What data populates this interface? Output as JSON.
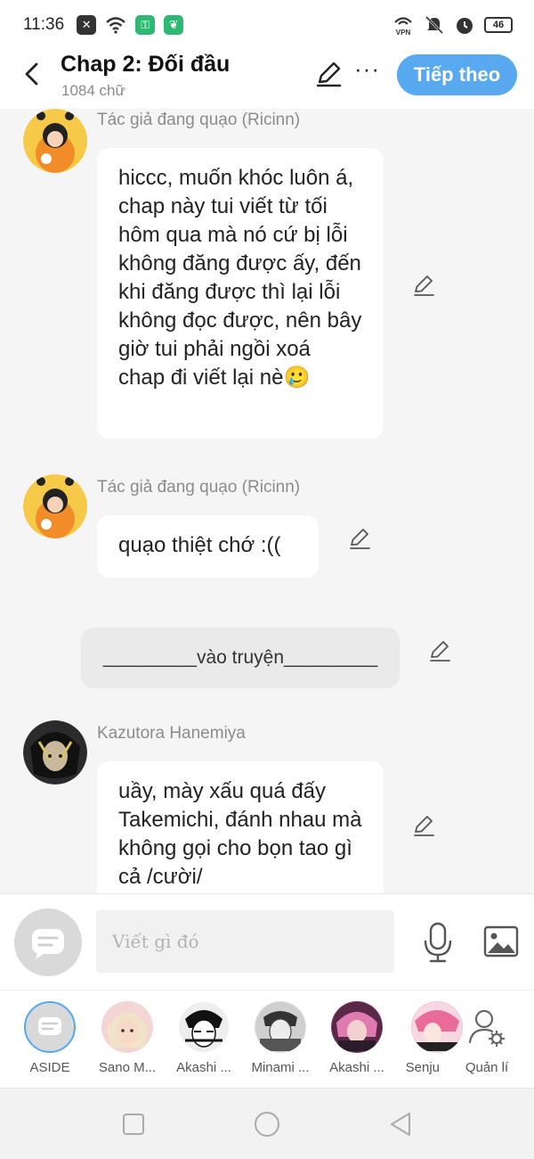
{
  "status_bar": {
    "time": "11:36",
    "battery": "46"
  },
  "header": {
    "title": "Chap 2: Đối đầu",
    "word_count": "1084 chữ",
    "more_label": "···",
    "next_button": "Tiếp theo"
  },
  "messages": [
    {
      "sender": "Tác giả đang quạo (Ricinn)",
      "text": "hiccc, muốn khóc luôn á, chap này tui viết từ tối hôm qua mà nó cứ bị lỗi không đăng được ấy, đến khi đăng được thì lại lỗi không đọc được, nên bây giờ tui phải ngồi xoá chap đi viết lại nè🥲"
    },
    {
      "sender": "Tác giả đang quạo (Ricinn)",
      "text": "quạo thiệt chớ :(("
    },
    {
      "narration": "_________vào truyện_________"
    },
    {
      "sender": "Kazutora Hanemiya",
      "text": "uầy, mày xấu quá đấy Takemichi, đánh nhau mà không gọi cho bọn tao gì cả /cười/"
    }
  ],
  "input": {
    "placeholder": "Viết gì đó"
  },
  "characters": [
    {
      "label": "ASIDE"
    },
    {
      "label": "Sano M..."
    },
    {
      "label": "Akashi ..."
    },
    {
      "label": "Minami ..."
    },
    {
      "label": "Akashi ..."
    },
    {
      "label": "Senju"
    },
    {
      "label": "Quản lí"
    }
  ],
  "colors": {
    "accent": "#58a9ef",
    "background": "#f5f5f5",
    "bubble": "#ffffff",
    "narration": "#eaeaea"
  }
}
